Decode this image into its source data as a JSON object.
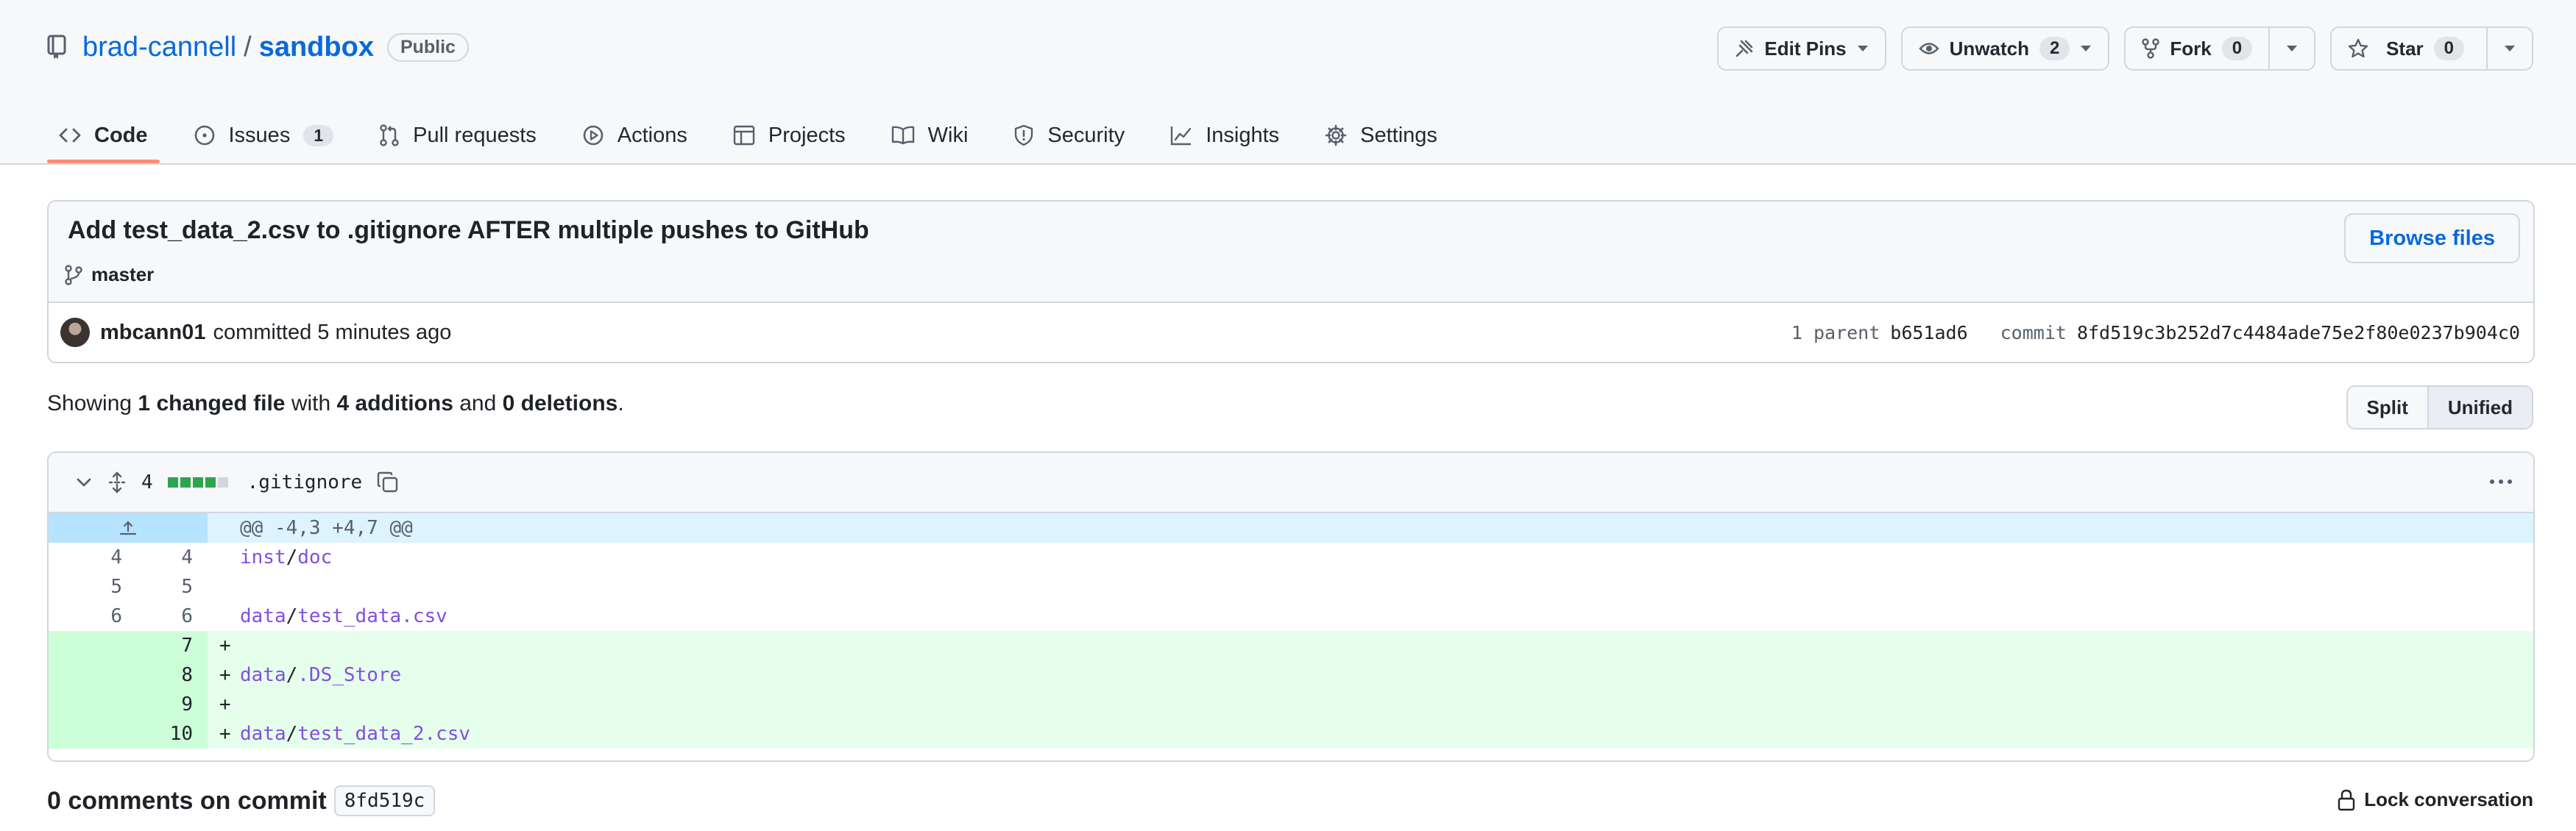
{
  "repo": {
    "owner": "brad-cannell",
    "name": "sandbox",
    "visibility": "Public"
  },
  "actions": {
    "edit_pins": "Edit Pins",
    "unwatch": "Unwatch",
    "watch_count": "2",
    "fork": "Fork",
    "fork_count": "0",
    "star": "Star",
    "star_count": "0"
  },
  "tabs": [
    {
      "label": "Code",
      "icon": "code-icon"
    },
    {
      "label": "Issues",
      "icon": "issue-icon",
      "count": "1"
    },
    {
      "label": "Pull requests",
      "icon": "pull-request-icon"
    },
    {
      "label": "Actions",
      "icon": "play-icon"
    },
    {
      "label": "Projects",
      "icon": "table-icon"
    },
    {
      "label": "Wiki",
      "icon": "book-icon"
    },
    {
      "label": "Security",
      "icon": "shield-icon"
    },
    {
      "label": "Insights",
      "icon": "graph-icon"
    },
    {
      "label": "Settings",
      "icon": "gear-icon"
    }
  ],
  "commit": {
    "title": "Add test_data_2.csv to .gitignore AFTER multiple pushes to GitHub",
    "branch": "master",
    "browse_files": "Browse files",
    "author": "mbcann01",
    "action": "committed 5 minutes ago",
    "parent_label": "1 parent",
    "parent_sha": "b651ad6",
    "commit_label": "commit",
    "sha": "8fd519c3b252d7c4484ade75e2f80e0237b904c0"
  },
  "summary": {
    "showing": "Showing",
    "changed": "1 changed file",
    "with": "with",
    "additions": "4 additions",
    "and": "and",
    "deletions": "0 deletions",
    "end": "."
  },
  "view": {
    "split": "Split",
    "unified": "Unified"
  },
  "file": {
    "changes": "4",
    "filename": ".gitignore",
    "hunk": "@@ -4,3 +4,7 @@",
    "lines": [
      {
        "old": "4",
        "new": "4",
        "sign": "",
        "dir": "inst",
        "sep": "/",
        "name": "doc",
        "type": "ctx"
      },
      {
        "old": "5",
        "new": "5",
        "sign": "",
        "dir": "",
        "sep": "",
        "name": "",
        "type": "ctx"
      },
      {
        "old": "6",
        "new": "6",
        "sign": "",
        "dir": "data",
        "sep": "/",
        "name": "test_data.csv",
        "type": "ctx"
      },
      {
        "old": "",
        "new": "7",
        "sign": "+",
        "dir": "",
        "sep": "",
        "name": "",
        "type": "add"
      },
      {
        "old": "",
        "new": "8",
        "sign": "+",
        "dir": "data",
        "sep": "/",
        "name": ".DS_Store",
        "type": "add"
      },
      {
        "old": "",
        "new": "9",
        "sign": "+",
        "dir": "",
        "sep": "",
        "name": "",
        "type": "add"
      },
      {
        "old": "",
        "new": "10",
        "sign": "+",
        "dir": "data",
        "sep": "/",
        "name": "test_data_2.csv",
        "type": "add"
      }
    ]
  },
  "comments": {
    "label": "0 comments on commit",
    "sha": "8fd519c",
    "lock": "Lock conversation"
  }
}
